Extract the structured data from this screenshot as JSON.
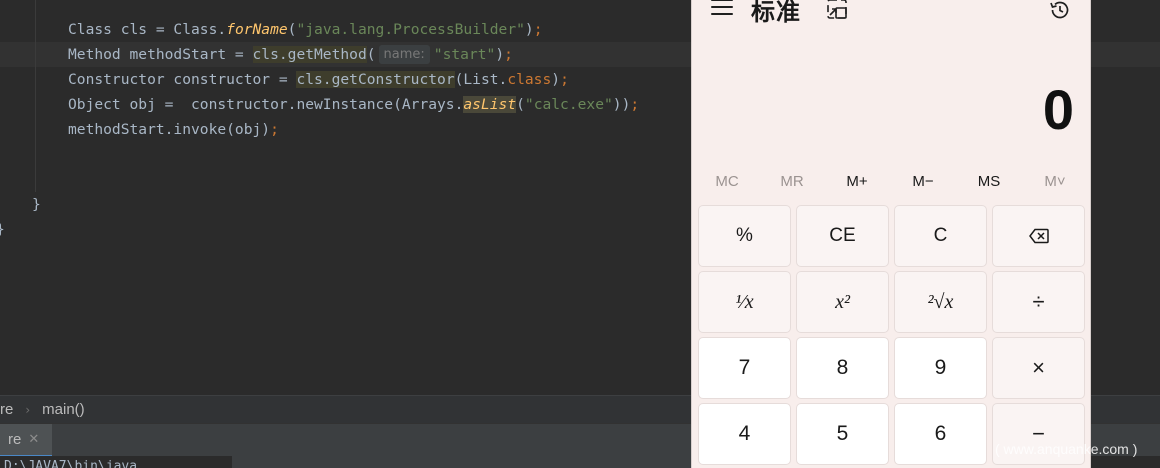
{
  "editor": {
    "lines": [
      {
        "p1": "Class cls = Class.",
        "fn": "forName",
        "p2": "(",
        "str": "\"java.lang.ProcessBuilder\"",
        "p3": ")",
        "semi": ";"
      },
      {
        "p0": "Method methodStart = ",
        "hl": "cls.getMethod",
        "p1": "(",
        "hint": "name:",
        "str": "\"start\"",
        "p2": ")",
        "semi": ";"
      },
      {
        "p0": "Constructor constructor = ",
        "hl": "cls.getConstructor",
        "p1": "(List.",
        "kw": "class",
        "p2": ")",
        "semi": ";"
      },
      {
        "p0": "Object obj =  constructor.newInstance(Arrays.",
        "fn": "asList",
        "p1": "(",
        "str": "\"calc.exe\"",
        "p2": "))",
        "semi": ";"
      },
      {
        "p0": "methodStart.invoke(obj)",
        "semi": ";"
      }
    ],
    "closing_brace_inner": "}",
    "closing_brace_outer": "}"
  },
  "breadcrumb": {
    "class_name": "re",
    "separator": "›",
    "method": "main()"
  },
  "run_panel": {
    "tab_label": "re",
    "close_glyph": "✕",
    "console_text": "D:\\JAVA7\\bin\\java..."
  },
  "calculator": {
    "mode_title": "标准",
    "display_value": "0",
    "memory": [
      {
        "label": "MC",
        "enabled": false
      },
      {
        "label": "MR",
        "enabled": false
      },
      {
        "label": "M+",
        "enabled": true
      },
      {
        "label": "M−",
        "enabled": true
      },
      {
        "label": "MS",
        "enabled": true
      },
      {
        "label": "M˅",
        "enabled": false
      }
    ],
    "keys": {
      "percent": "%",
      "ce": "CE",
      "clear": "C",
      "reciprocal": "¹⁄x",
      "square": "x²",
      "sqrt": "²√x",
      "divide": "÷",
      "seven": "7",
      "eight": "8",
      "nine": "9",
      "multiply": "×",
      "four": "4",
      "five": "5",
      "six": "6",
      "minus": "−"
    },
    "icons": {
      "menu": "hamburger-icon",
      "keep_on_top": "keep-on-top-icon",
      "history": "history-icon",
      "backspace": "backspace-icon"
    }
  },
  "watermark": "( www.anquanke.com )"
}
